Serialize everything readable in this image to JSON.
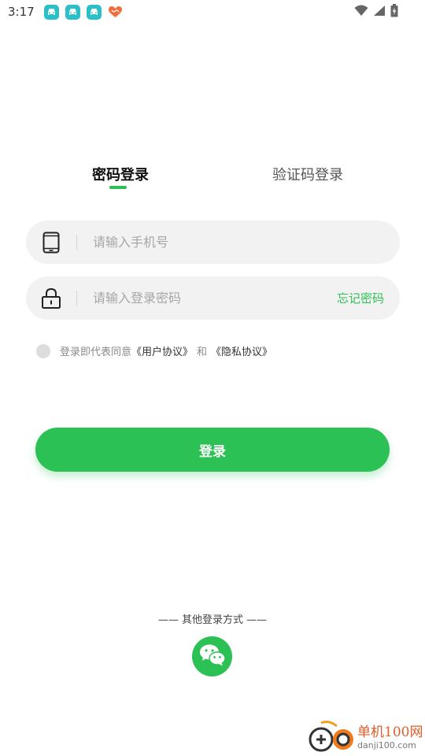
{
  "status_bar": {
    "time": "3:17",
    "notification_icons": [
      "car-app-icon",
      "car-app-icon",
      "car-app-icon",
      "heart-app-icon"
    ],
    "right_icons": [
      "wifi-icon",
      "signal-icon",
      "battery-icon"
    ]
  },
  "tabs": {
    "password_login": "密码登录",
    "sms_login": "验证码登录",
    "active": "password_login"
  },
  "phone_field": {
    "icon": "phone-icon",
    "placeholder": "请输入手机号",
    "value": ""
  },
  "password_field": {
    "icon": "lock-icon",
    "placeholder": "请输入登录密码",
    "value": "",
    "forgot_label": "忘记密码"
  },
  "agreement": {
    "checked": false,
    "prefix": "登录即代表同意",
    "user_agreement": "《用户协议》",
    "and": "和",
    "privacy_policy": "《隐私协议》"
  },
  "login_button": {
    "label": "登录"
  },
  "other_login": {
    "label": "—— 其他登录方式 ——",
    "wechat_icon": "wechat-icon"
  },
  "watermark": {
    "name": "单机100网",
    "url": "danji100.com"
  },
  "colors": {
    "accent": "#2cc155",
    "field_bg": "#f2f2f2",
    "placeholder": "#a6a6a6"
  }
}
